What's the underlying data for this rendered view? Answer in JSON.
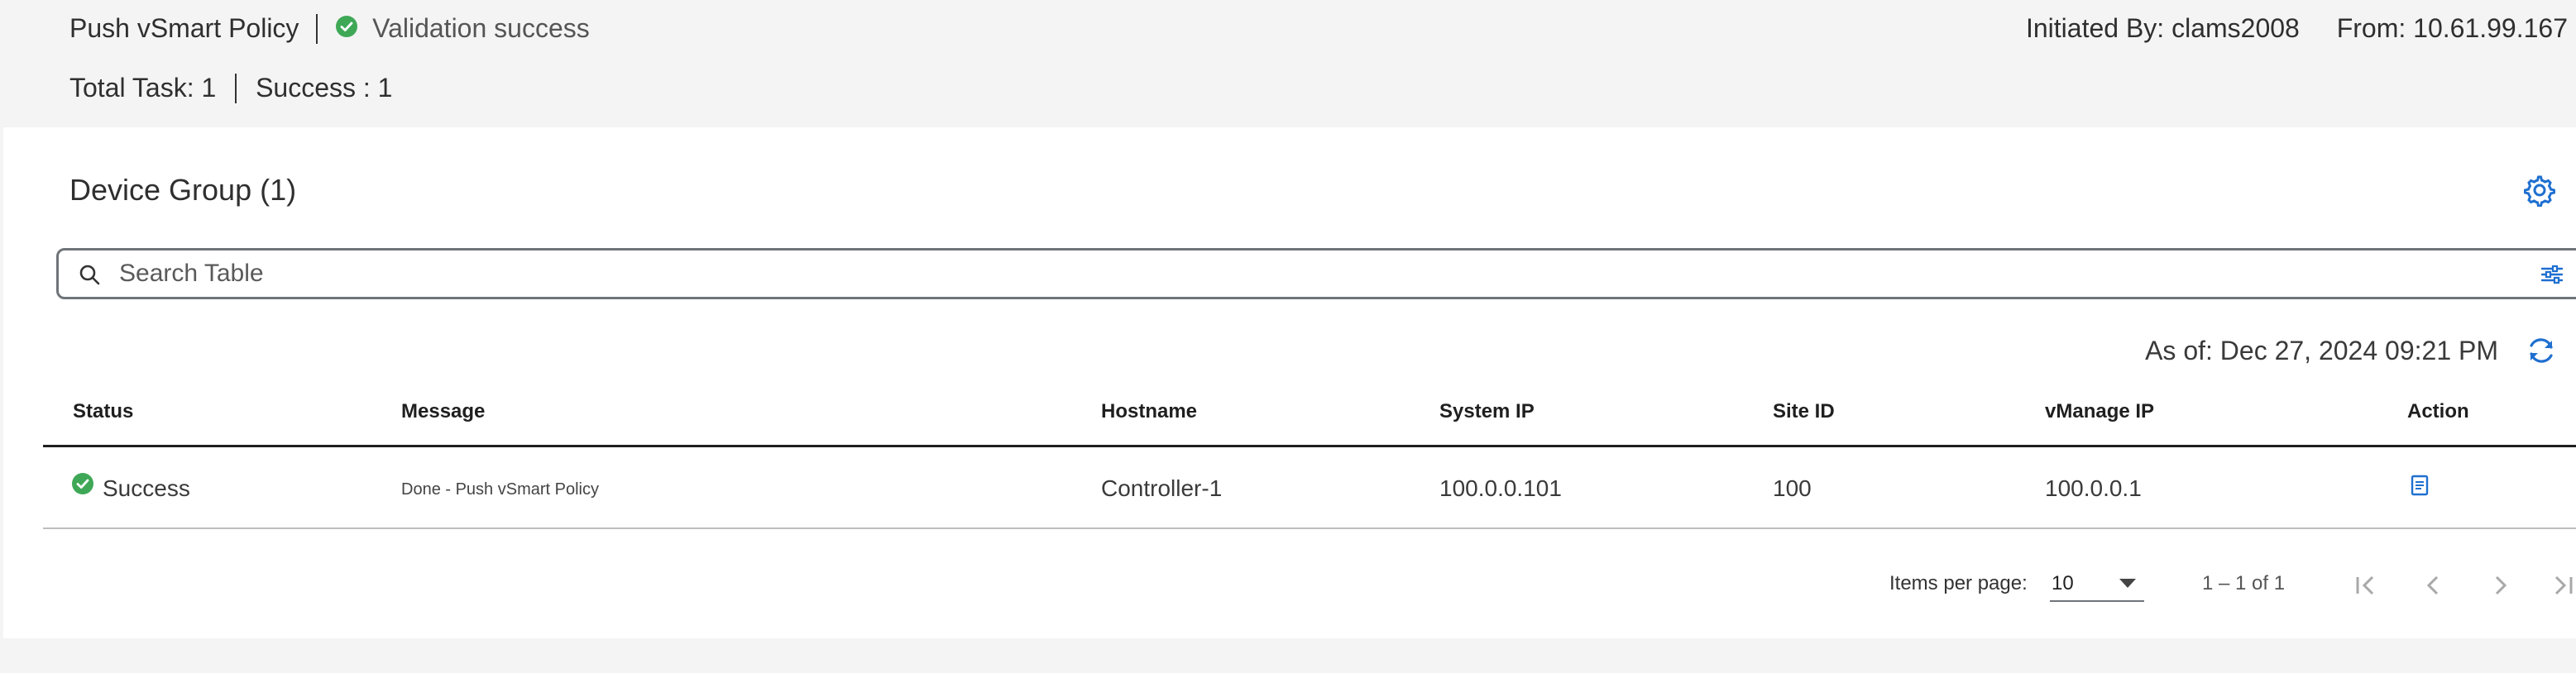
{
  "header": {
    "task_title": "Push vSmart Policy",
    "validation_status": "Validation success",
    "initiated_by": "Initiated By: clams2008",
    "from": "From: 10.61.99.167",
    "total_task": "Total Task: 1",
    "success_count": "Success : 1"
  },
  "group": {
    "title": "Device Group (1)"
  },
  "search": {
    "placeholder": "Search Table"
  },
  "as_of": "As of: Dec 27, 2024 09:21 PM",
  "table": {
    "columns": [
      "Status",
      "Message",
      "Hostname",
      "System IP",
      "Site ID",
      "vManage IP",
      "Action"
    ],
    "rows": [
      {
        "status": "Success",
        "message": "Done - Push vSmart Policy",
        "hostname": "Controller-1",
        "system_ip": "100.0.0.101",
        "site_id": "100",
        "vmanage_ip": "100.0.0.1",
        "action_icon": "document-icon"
      }
    ]
  },
  "pagination": {
    "items_per_page_label": "Items per page:",
    "items_per_page_value": "10",
    "range": "1 – 1 of 1"
  },
  "colors": {
    "success_green": "#3fa857",
    "accent_blue": "#1f6fd0"
  }
}
